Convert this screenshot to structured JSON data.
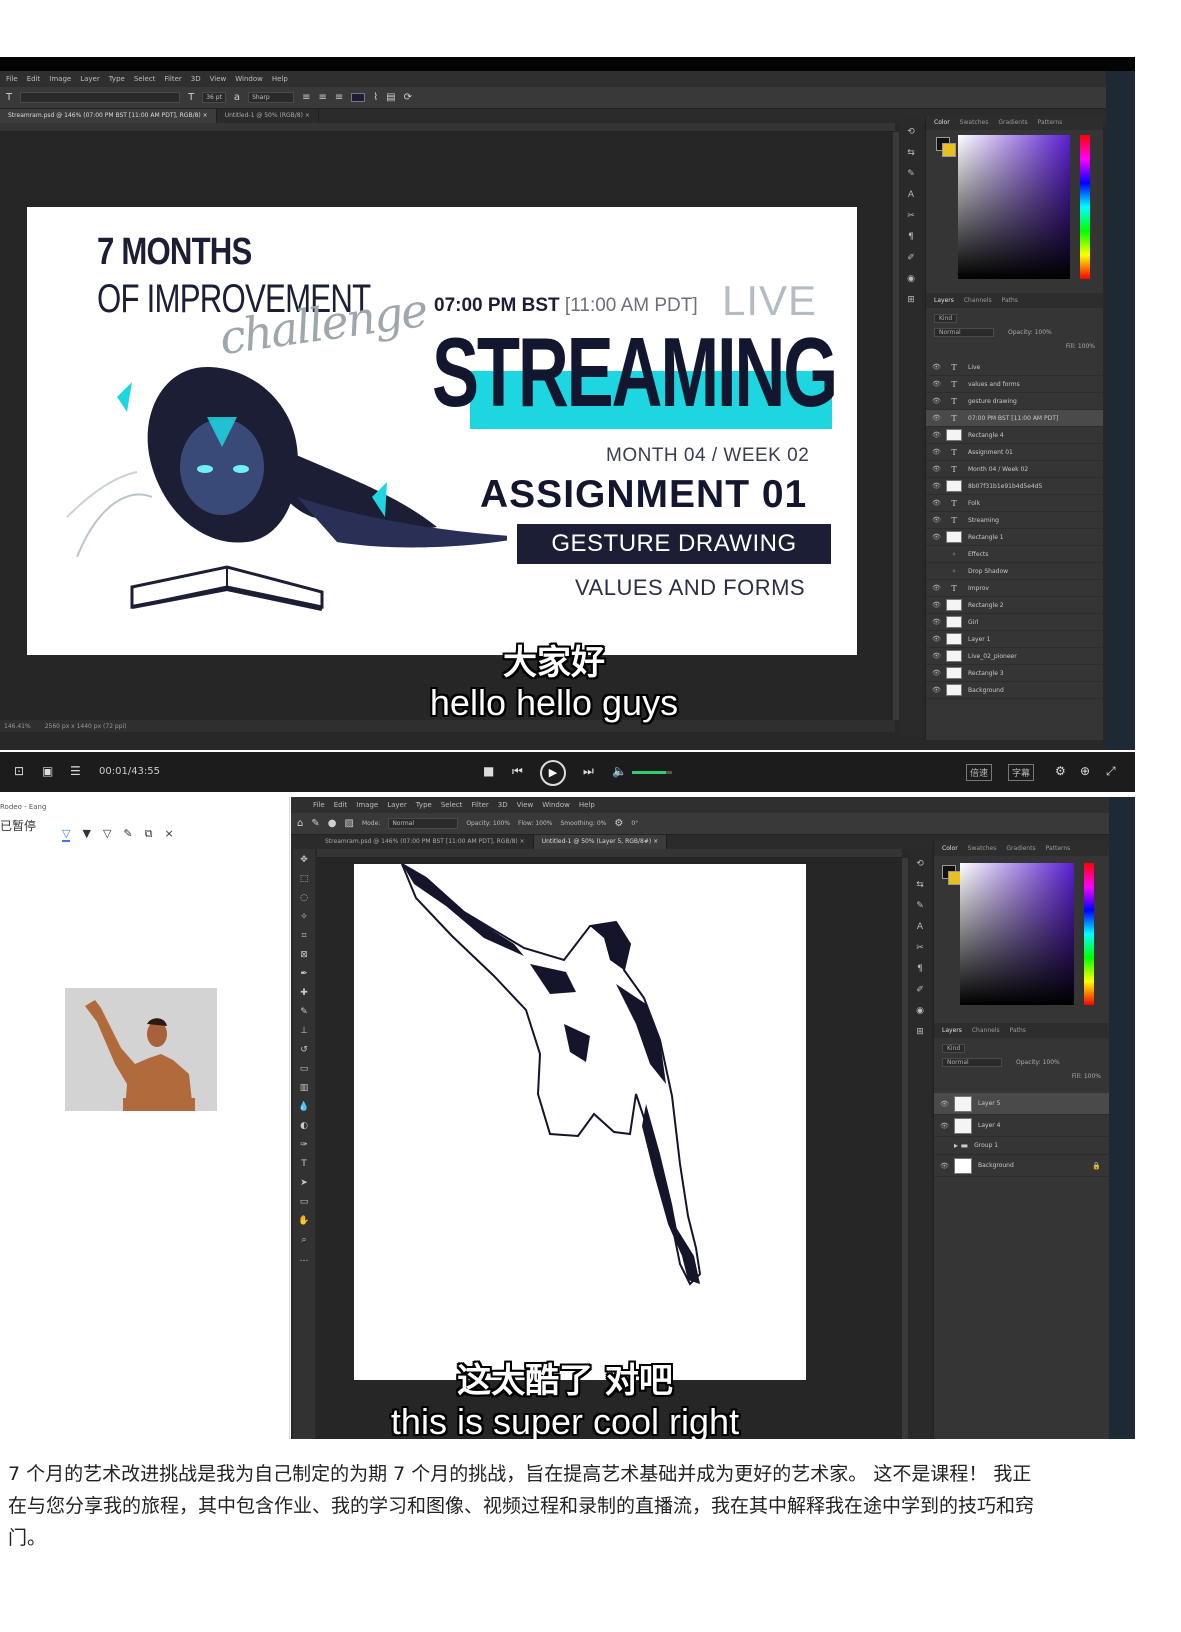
{
  "top_window": {
    "menu": [
      "File",
      "Edit",
      "Image",
      "Layer",
      "Type",
      "Select",
      "Filter",
      "3D",
      "View",
      "Window",
      "Help"
    ],
    "options": {
      "font_size": "36 pt",
      "antialias": "Sharp"
    },
    "tabs": [
      "Streamram.psd @ 146% (07:00 PM BST [11:00 AM PDT], RGB/8) ×",
      "Untitled-1 @ 50% (RGB/8) ×"
    ],
    "status_left": "146.41%",
    "status_doc": "2560 px x 1440 px (72 ppi)",
    "panel_tabs": [
      "Color",
      "Swatches",
      "Gradients",
      "Patterns"
    ],
    "layers_tabs": [
      "Layers",
      "Channels",
      "Paths"
    ],
    "layers_filter": "Kind",
    "blend_mode": "Normal",
    "opacity": "Opacity: 100%",
    "fill": "Fill: 100%",
    "layers": [
      {
        "name": "Live",
        "kind": "text"
      },
      {
        "name": "values and forms",
        "kind": "text"
      },
      {
        "name": "gesture drawing",
        "kind": "text"
      },
      {
        "name": "07:00 PM BST [11:00 AM PDT]",
        "kind": "text",
        "selected": true
      },
      {
        "name": "Rectangle 4",
        "kind": "shape"
      },
      {
        "name": "Assignment 01",
        "kind": "text"
      },
      {
        "name": "Month 04 / Week 02",
        "kind": "text"
      },
      {
        "name": "8b07f31b1e91b4d5e4d5",
        "kind": "shape"
      },
      {
        "name": "Folk",
        "kind": "text"
      },
      {
        "name": "Streaming",
        "kind": "text"
      },
      {
        "name": "Rectangle 1",
        "kind": "shape"
      },
      {
        "name": "Effects",
        "kind": "fx"
      },
      {
        "name": "Drop Shadow",
        "kind": "fx"
      },
      {
        "name": "Improv",
        "kind": "text"
      },
      {
        "name": "Rectangle 2",
        "kind": "shape"
      },
      {
        "name": "Girl",
        "kind": "shape"
      },
      {
        "name": "Layer 1",
        "kind": "shape"
      },
      {
        "name": "Live_02_pioneer",
        "kind": "shape"
      },
      {
        "name": "Rectangle 3",
        "kind": "shape"
      },
      {
        "name": "Background",
        "kind": "shape"
      }
    ]
  },
  "banner": {
    "line1": "7 MONTHS",
    "line2": "OF IMPROVEMENT",
    "script": "challenge",
    "time_bold": "07:00 PM BST",
    "time_rest": " [11:00 AM PDT]",
    "live": "LIVE",
    "streaming": "STREAMING",
    "month": "MONTH 04 / WEEK 02",
    "assignment": "ASSIGNMENT 01",
    "gesture": "GESTURE DRAWING",
    "values": "VALUES AND FORMS"
  },
  "subtitle_top": {
    "cn": "大家好",
    "en": "hello hello guys"
  },
  "player": {
    "time": "00:01/43:55",
    "right_buttons": [
      "倍速",
      "字幕"
    ]
  },
  "bottom_window": {
    "menu": [
      "File",
      "Edit",
      "Image",
      "Layer",
      "Type",
      "Select",
      "Filter",
      "3D",
      "View",
      "Window",
      "Help"
    ],
    "options": {
      "mode": "Normal",
      "opacity": "Opacity: 100%",
      "flow": "Flow: 100%",
      "smoothing": "Smoothing: 0%",
      "angle": "0°"
    },
    "tabs": [
      "Streamram.psd @ 146% (07:00 PM BST [11:00 AM PDT], RGB/8) ×",
      "Untitled-1 @ 50% (Layer 5, RGB/8#) ×"
    ],
    "panel_tabs": [
      "Color",
      "Swatches",
      "Gradients",
      "Patterns"
    ],
    "layers_tabs": [
      "Layers",
      "Channels",
      "Paths"
    ],
    "layers_filter": "Kind",
    "blend_mode": "Normal",
    "opacity": "Opacity: 100%",
    "fill": "Fill: 100%",
    "layers": [
      {
        "name": "Layer 5",
        "selected": true
      },
      {
        "name": "Layer 4"
      },
      {
        "name": "Group 1"
      },
      {
        "name": "Background"
      }
    ]
  },
  "ref_panel": {
    "title": "Rodeo - Eang",
    "caption": "已暂停",
    "tools": [
      "filter-icon",
      "filter-icon",
      "filter-icon",
      "edit-icon",
      "copy-icon",
      "close-icon"
    ],
    "close_glyph": "×"
  },
  "subtitle_bottom": {
    "cn": "这太酷了 对吧",
    "en": "this is super cool right"
  },
  "description": "7 个月的艺术改进挑战是我为自己制定的为期 7 个月的挑战，旨在提高艺术基础并成为更好的艺术家。 这不是课程！ 我正在与您分享我的旅程，其中包含作业、我的学习和图像、视频过程和录制的直播流，我在其中解释我在途中学到的技巧和窍门。",
  "colors": {
    "accent_cyan": "#1ed6e0",
    "navy": "#1b1e35",
    "ps_bg": "#282828"
  }
}
